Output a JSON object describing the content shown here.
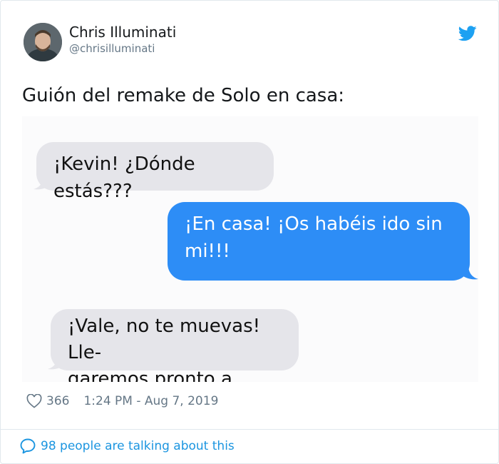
{
  "author": {
    "name": "Chris Illuminati",
    "handle": "@chrisilluminati",
    "avatar_icon": "avatar-photo"
  },
  "brand": {
    "icon": "twitter-bird-icon",
    "color": "#1da1f2"
  },
  "tweet": {
    "text": "Guión del remake de Solo en casa:"
  },
  "chat": {
    "messages": [
      {
        "side": "incoming",
        "text": "¡Kevin! ¿Dónde estás???"
      },
      {
        "side": "outgoing",
        "text": "¡En casa! ¡Os habéis ido sin\nmi!!!"
      },
      {
        "side": "incoming",
        "text": "¡Vale, no te muevas! Lle-\ngaremos pronto a casa."
      }
    ],
    "colors": {
      "incoming": "#e5e5ea",
      "outgoing": "#2d8df6"
    }
  },
  "footer": {
    "likes_count": "366",
    "timestamp": "1:24 PM - Aug 7, 2019",
    "like_icon": "heart-icon",
    "talking_text": "98 people are talking about this",
    "talking_icon": "reply-bubble-icon"
  }
}
